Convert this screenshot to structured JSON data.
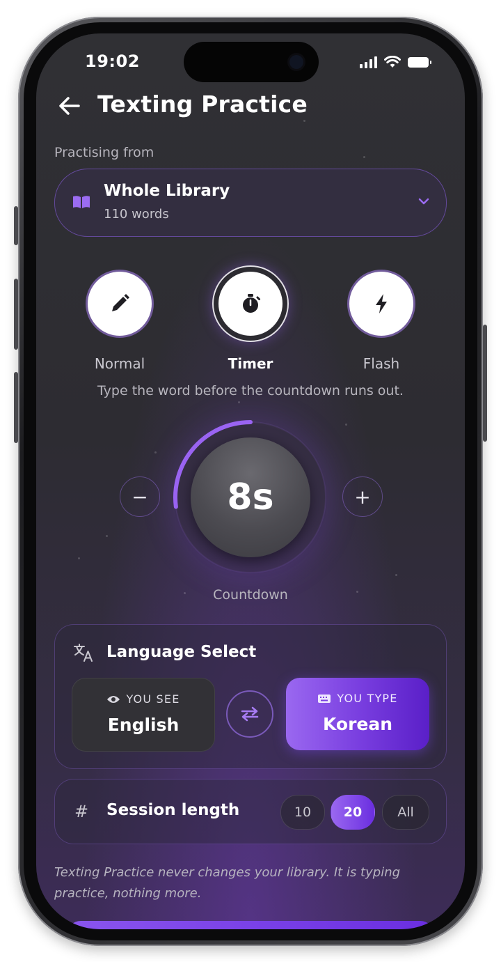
{
  "status_bar": {
    "time": "19:02"
  },
  "header": {
    "title": "Texting Practice",
    "back_icon": "arrow-left-icon"
  },
  "source": {
    "label": "Practising from",
    "selected": "Whole Library",
    "count": "110 words",
    "icon": "book-icon"
  },
  "modes": [
    {
      "label": "Normal",
      "icon": "pencil-icon",
      "active": false
    },
    {
      "label": "Timer",
      "icon": "stopwatch-icon",
      "active": true
    },
    {
      "label": "Flash",
      "icon": "lightning-icon",
      "active": false
    }
  ],
  "mode_description": "Type the word before the countdown runs out.",
  "countdown": {
    "value": "8s",
    "label": "Countdown",
    "decrease": "−",
    "increase": "+",
    "progress": 0.27
  },
  "language": {
    "title": "Language Select",
    "see_caption": "YOU SEE",
    "see_value": "English",
    "type_caption": "YOU TYPE",
    "type_value": "Korean"
  },
  "session": {
    "title": "Session length",
    "icon": "hash-icon",
    "options": [
      "10",
      "20",
      "All"
    ],
    "selected": "20"
  },
  "note": "Texting Practice never changes your library. It is typing practice, nothing more.",
  "colors": {
    "accent": "#8a55ee",
    "accent_dark": "#5a1fc8",
    "background": "#2e2d33"
  }
}
